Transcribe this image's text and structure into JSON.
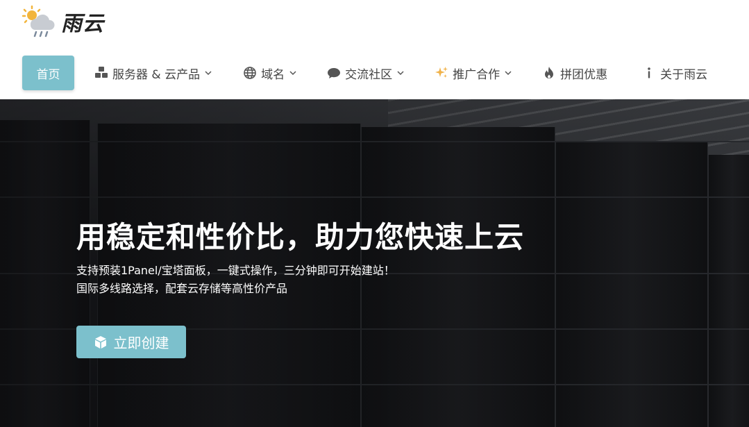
{
  "brand": {
    "name": "雨云"
  },
  "nav": {
    "items": [
      {
        "label": "首页",
        "icon": "",
        "dropdown": false
      },
      {
        "label": "服务器 & 云产品",
        "icon": "cubes-icon",
        "dropdown": true
      },
      {
        "label": "域名",
        "icon": "globe-icon",
        "dropdown": true
      },
      {
        "label": "交流社区",
        "icon": "chat-bubble-icon",
        "dropdown": true
      },
      {
        "label": "推广合作",
        "icon": "sparkles-icon",
        "dropdown": true
      },
      {
        "label": "拼团优惠",
        "icon": "fire-icon",
        "dropdown": false
      },
      {
        "label": "关于雨云",
        "icon": "info-icon",
        "dropdown": false
      }
    ]
  },
  "hero": {
    "title": "用稳定和性价比，助力您快速上云",
    "subtitle_line1": "支持预装1Panel/宝塔面板，一键式操作，三分钟即可开始建站！",
    "subtitle_line2": "国际多线路选择，配套云存储等高性价产品",
    "cta_label": "立即创建",
    "cta_icon": "cube-icon"
  },
  "colors": {
    "accent": "#7cc0cc",
    "hero_bg": "#1d1f22",
    "text": "#444444"
  }
}
